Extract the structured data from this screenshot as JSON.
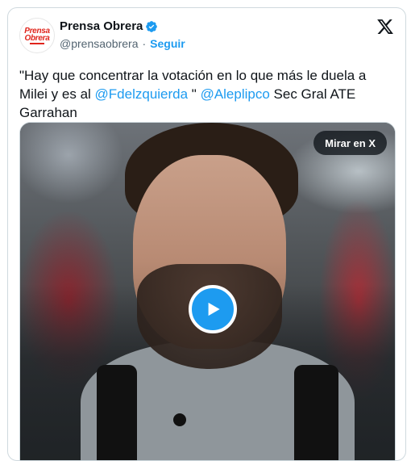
{
  "account": {
    "avatar_line1": "Prensa",
    "avatar_line2": "Obrera",
    "name": "Prensa Obrera",
    "handle": "@prensaobrera",
    "separator": "·",
    "follow_label": "Seguir"
  },
  "tweet": {
    "text_before": "\"Hay que concentrar la votación en lo que más le duela a Milei y es al ",
    "mention1": "@Fdelzquierda",
    "text_middle": " \" ",
    "mention2": "@Aleplipco",
    "text_after": " Sec Gral ATE Garrahan"
  },
  "media": {
    "watch_on_x_label": "Mirar en X"
  },
  "colors": {
    "accent": "#1d9bf0",
    "text": "#0f1419",
    "muted": "#536471",
    "brand_red": "#e0241b"
  },
  "icons": {
    "verified": "verified-badge-icon",
    "platform": "x-logo-icon",
    "play": "play-icon"
  }
}
